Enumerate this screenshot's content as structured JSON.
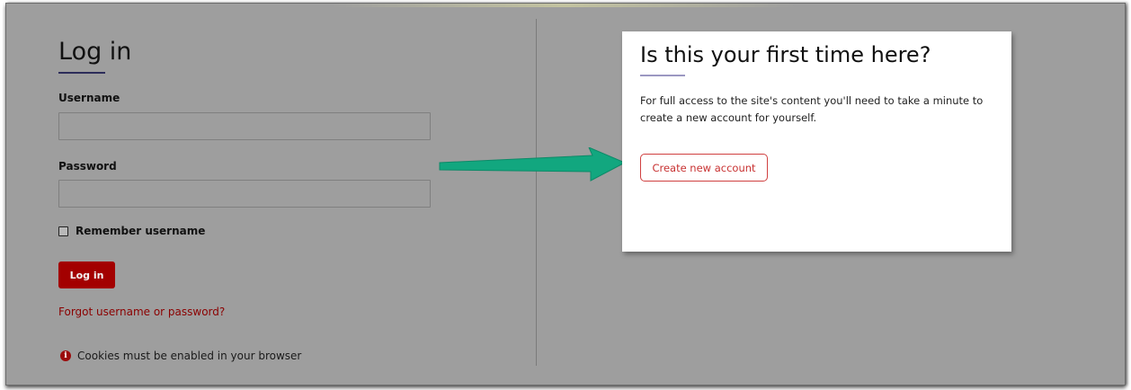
{
  "login": {
    "title": "Log in",
    "username_label": "Username",
    "username_value": "",
    "password_label": "Password",
    "password_value": "",
    "remember_label": "Remember username",
    "remember_checked": false,
    "login_button": "Log in",
    "forgot_link": "Forgot username or password?",
    "cookie_note": "Cookies must be enabled in your browser",
    "cookie_icon": "info-icon"
  },
  "signup": {
    "title": "Is this your first time here?",
    "text": "For full access to the site's content you'll need to take a minute to create a new account for yourself.",
    "create_button": "Create new account"
  },
  "annotation": {
    "arrow_color": "#12a77f",
    "arrow_icon": "arrow-right-icon"
  },
  "colors": {
    "background": "#9e9e9e",
    "primary": "#a30000",
    "link": "#8b0000",
    "card": "#ffffff"
  }
}
